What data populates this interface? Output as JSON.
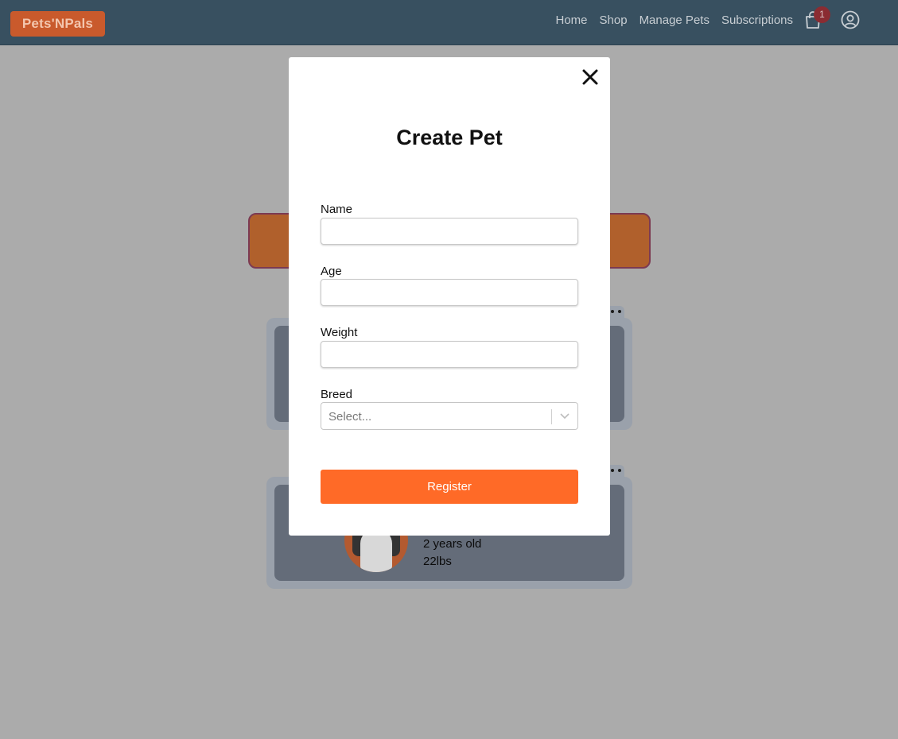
{
  "navbar": {
    "logo": "Pets'NPals",
    "links": [
      "Home",
      "Shop",
      "Manage Pets",
      "Subscriptions"
    ],
    "cart_count": "1",
    "icons": [
      "shopping-bag-icon",
      "user-circle-icon"
    ]
  },
  "background": {
    "pet_card_2": {
      "age": "2 years old",
      "weight": "22lbs"
    }
  },
  "modal": {
    "title": "Create Pet",
    "fields": {
      "name": {
        "label": "Name",
        "value": ""
      },
      "age": {
        "label": "Age",
        "value": ""
      },
      "weight": {
        "label": "Weight",
        "value": ""
      },
      "breed": {
        "label": "Breed",
        "placeholder": "Select..."
      }
    },
    "submit_label": "Register",
    "close_icon": "close-icon"
  },
  "colors": {
    "navbar": "#385060",
    "brand_orange": "#ff6a27",
    "backdrop": "#ababab",
    "badge": "#8a2c32"
  }
}
